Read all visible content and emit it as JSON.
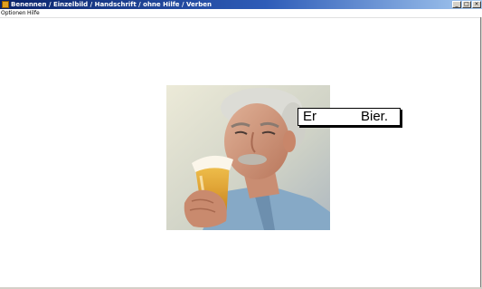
{
  "window": {
    "title": "Benennen / Einzelbild / Handschrift / ohne Hilfe / Verben",
    "buttons": [
      "_",
      "□",
      "×"
    ]
  },
  "menu": {
    "items": [
      "Optionen",
      "Hilfe"
    ]
  },
  "exercise": {
    "image_alt": "man drinking beer",
    "word_before_gap": "Er",
    "word_after_gap": "Bier."
  },
  "colors": {
    "titlebar_start": "#0a246a",
    "titlebar_end": "#a6caf0",
    "beer": "#e8a21a",
    "shirt": "#7fa6c8"
  }
}
